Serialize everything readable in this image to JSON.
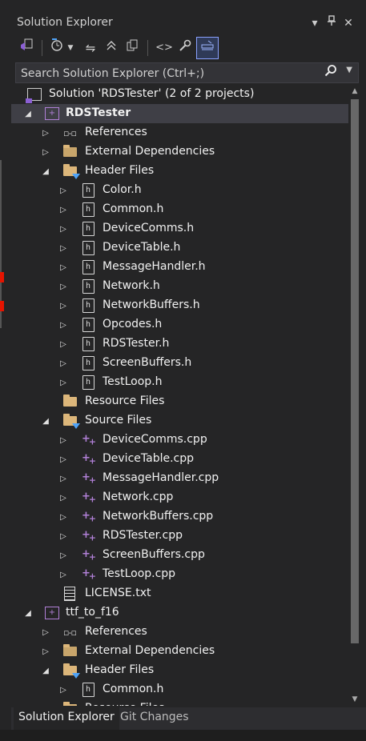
{
  "panel": {
    "title": "Solution Explorer",
    "buttons": {
      "dropdown": "▾",
      "pin": "📌",
      "close": "✕"
    }
  },
  "toolbar": {
    "icons": [
      "vs-home-icon",
      "history-icon",
      "sync-icon",
      "collapse-all-icon",
      "switch-views-icon",
      "code-view-icon",
      "properties-wrench-icon",
      "preview-selected-icon"
    ]
  },
  "search": {
    "placeholder": "Search Solution Explorer (Ctrl+;)"
  },
  "tree": [
    {
      "label": "Solution 'RDSTester' (2 of 2 projects)",
      "depth": 0,
      "icon": "solution-icon",
      "exp": "none"
    },
    {
      "label": "RDSTester",
      "depth": 1,
      "icon": "project-icon",
      "exp": "open",
      "selected": true
    },
    {
      "label": "References",
      "depth": 2,
      "icon": "references-icon",
      "exp": "closed"
    },
    {
      "label": "External Dependencies",
      "depth": 2,
      "icon": "external-deps-icon",
      "exp": "closed"
    },
    {
      "label": "Header Files",
      "depth": 2,
      "icon": "filter-folder-icon",
      "exp": "open"
    },
    {
      "label": "Color.h",
      "depth": 3,
      "icon": "header-file-icon",
      "exp": "closed"
    },
    {
      "label": "Common.h",
      "depth": 3,
      "icon": "header-file-icon",
      "exp": "closed"
    },
    {
      "label": "DeviceComms.h",
      "depth": 3,
      "icon": "header-file-icon",
      "exp": "closed"
    },
    {
      "label": "DeviceTable.h",
      "depth": 3,
      "icon": "header-file-icon",
      "exp": "closed"
    },
    {
      "label": "MessageHandler.h",
      "depth": 3,
      "icon": "header-file-icon",
      "exp": "closed"
    },
    {
      "label": "Network.h",
      "depth": 3,
      "icon": "header-file-icon",
      "exp": "closed"
    },
    {
      "label": "NetworkBuffers.h",
      "depth": 3,
      "icon": "header-file-icon",
      "exp": "closed"
    },
    {
      "label": "Opcodes.h",
      "depth": 3,
      "icon": "header-file-icon",
      "exp": "closed"
    },
    {
      "label": "RDSTester.h",
      "depth": 3,
      "icon": "header-file-icon",
      "exp": "closed"
    },
    {
      "label": "ScreenBuffers.h",
      "depth": 3,
      "icon": "header-file-icon",
      "exp": "closed"
    },
    {
      "label": "TestLoop.h",
      "depth": 3,
      "icon": "header-file-icon",
      "exp": "closed"
    },
    {
      "label": "Resource Files",
      "depth": 2,
      "icon": "folder-icon",
      "exp": "none"
    },
    {
      "label": "Source Files",
      "depth": 2,
      "icon": "filter-folder-icon",
      "exp": "open"
    },
    {
      "label": "DeviceComms.cpp",
      "depth": 3,
      "icon": "cpp-file-icon",
      "exp": "closed"
    },
    {
      "label": "DeviceTable.cpp",
      "depth": 3,
      "icon": "cpp-file-icon",
      "exp": "closed"
    },
    {
      "label": "MessageHandler.cpp",
      "depth": 3,
      "icon": "cpp-file-icon",
      "exp": "closed"
    },
    {
      "label": "Network.cpp",
      "depth": 3,
      "icon": "cpp-file-icon",
      "exp": "closed"
    },
    {
      "label": "NetworkBuffers.cpp",
      "depth": 3,
      "icon": "cpp-file-icon",
      "exp": "closed"
    },
    {
      "label": "RDSTester.cpp",
      "depth": 3,
      "icon": "cpp-file-icon",
      "exp": "closed"
    },
    {
      "label": "ScreenBuffers.cpp",
      "depth": 3,
      "icon": "cpp-file-icon",
      "exp": "closed"
    },
    {
      "label": "TestLoop.cpp",
      "depth": 3,
      "icon": "cpp-file-icon",
      "exp": "closed"
    },
    {
      "label": "LICENSE.txt",
      "depth": 2,
      "icon": "text-file-icon",
      "exp": "none"
    },
    {
      "label": "ttf_to_f16",
      "depth": 1,
      "icon": "project-icon",
      "exp": "open"
    },
    {
      "label": "References",
      "depth": 2,
      "icon": "references-icon",
      "exp": "closed"
    },
    {
      "label": "External Dependencies",
      "depth": 2,
      "icon": "external-deps-icon",
      "exp": "closed"
    },
    {
      "label": "Header Files",
      "depth": 2,
      "icon": "filter-folder-icon",
      "exp": "open"
    },
    {
      "label": "Common.h",
      "depth": 3,
      "icon": "header-file-icon",
      "exp": "closed"
    },
    {
      "label": "Resource Files",
      "depth": 2,
      "icon": "folder-icon",
      "exp": "none"
    }
  ],
  "tabs": [
    {
      "label": "Solution Explorer",
      "active": true
    },
    {
      "label": "Git Changes",
      "active": false
    }
  ]
}
